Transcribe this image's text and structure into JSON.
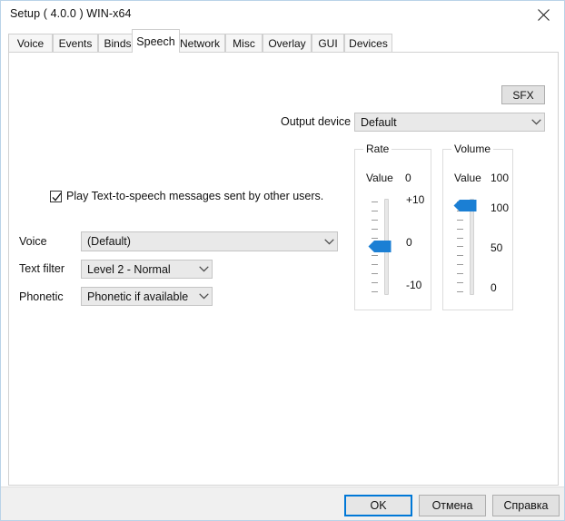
{
  "window": {
    "title": "Setup ( 4.0.0 ) WIN-x64",
    "close_icon": "close-icon"
  },
  "tabs": [
    {
      "label": "Voice",
      "selected": false
    },
    {
      "label": "Events",
      "selected": false
    },
    {
      "label": "Binds",
      "selected": false
    },
    {
      "label": "Speech",
      "selected": true
    },
    {
      "label": "Network",
      "selected": false
    },
    {
      "label": "Misc",
      "selected": false
    },
    {
      "label": "Overlay",
      "selected": false
    },
    {
      "label": "GUI",
      "selected": false
    },
    {
      "label": "Devices",
      "selected": false
    }
  ],
  "speech_panel": {
    "sfx_button": "SFX",
    "output_device": {
      "label": "Output device",
      "value": "Default"
    },
    "tts_checkbox": {
      "label": "Play Text-to-speech messages sent by other users.",
      "checked": true
    },
    "voice": {
      "label": "Voice",
      "value": "(Default)"
    },
    "text_filter": {
      "label": "Text filter",
      "value": "Level 2 - Normal"
    },
    "phonetic": {
      "label": "Phonetic",
      "value": "Phonetic if available"
    },
    "rate_group": {
      "title": "Rate",
      "value_label": "Value",
      "value": "0",
      "scale_top": "+10",
      "scale_mid": "0",
      "scale_bottom": "-10"
    },
    "volume_group": {
      "title": "Volume",
      "value_label": "Value",
      "value": "100",
      "scale_top": "100",
      "scale_mid": "50",
      "scale_bottom": "0"
    }
  },
  "footer": {
    "ok": "OK",
    "cancel": "Отмена",
    "help": "Справка"
  },
  "colors": {
    "accent": "#0078d7",
    "thumb": "#1b7fd4",
    "button_face": "#e1e1e1",
    "combo_face": "#e9e9e9",
    "footer": "#f0f0f0"
  }
}
